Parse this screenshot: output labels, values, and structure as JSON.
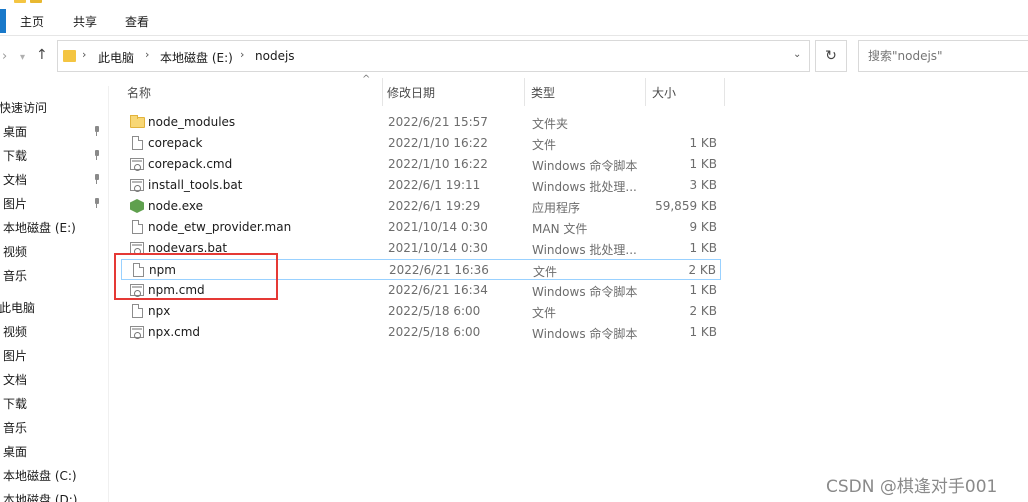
{
  "ribbon": {
    "tabs": [
      "主页",
      "共享",
      "查看"
    ]
  },
  "address": {
    "crumbs": [
      "此电脑",
      "本地磁盘 (E:)",
      "nodejs"
    ],
    "search_placeholder": "搜索\"nodejs\""
  },
  "sidebar": {
    "items": [
      {
        "label": "快速访问",
        "pinned": false,
        "head": true
      },
      {
        "label": "桌面",
        "pinned": true
      },
      {
        "label": "下载",
        "pinned": true
      },
      {
        "label": "文档",
        "pinned": true
      },
      {
        "label": "图片",
        "pinned": true
      },
      {
        "label": "本地磁盘 (E:)",
        "pinned": false
      },
      {
        "label": "视频",
        "pinned": false
      },
      {
        "label": "音乐",
        "pinned": false
      },
      {
        "label": "此电脑",
        "pinned": false,
        "head": true
      },
      {
        "label": "视频",
        "pinned": false
      },
      {
        "label": "图片",
        "pinned": false
      },
      {
        "label": "文档",
        "pinned": false
      },
      {
        "label": "下载",
        "pinned": false
      },
      {
        "label": "音乐",
        "pinned": false
      },
      {
        "label": "桌面",
        "pinned": false
      },
      {
        "label": "本地磁盘 (C:)",
        "pinned": false
      },
      {
        "label": "本地磁盘 (D:)",
        "pinned": false
      }
    ]
  },
  "columns": {
    "name": "名称",
    "date": "修改日期",
    "type": "类型",
    "size": "大小"
  },
  "files": [
    {
      "name": "node_modules",
      "date": "2022/6/21 15:57",
      "type": "文件夹",
      "size": "",
      "icon": "folder-icon"
    },
    {
      "name": "corepack",
      "date": "2022/1/10 16:22",
      "type": "文件",
      "size": "1 KB",
      "icon": "file-icon"
    },
    {
      "name": "corepack.cmd",
      "date": "2022/1/10 16:22",
      "type": "Windows 命令脚本",
      "size": "1 KB",
      "icon": "script-icon"
    },
    {
      "name": "install_tools.bat",
      "date": "2022/6/1 19:11",
      "type": "Windows 批处理...",
      "size": "3 KB",
      "icon": "script-icon"
    },
    {
      "name": "node.exe",
      "date": "2022/6/1 19:29",
      "type": "应用程序",
      "size": "59,859 KB",
      "icon": "nodejs-icon"
    },
    {
      "name": "node_etw_provider.man",
      "date": "2021/10/14 0:30",
      "type": "MAN 文件",
      "size": "9 KB",
      "icon": "file-icon"
    },
    {
      "name": "nodevars.bat",
      "date": "2021/10/14 0:30",
      "type": "Windows 批处理...",
      "size": "1 KB",
      "icon": "script-icon"
    },
    {
      "name": "npm",
      "date": "2022/6/21 16:36",
      "type": "文件",
      "size": "2 KB",
      "icon": "file-icon",
      "selected": true
    },
    {
      "name": "npm.cmd",
      "date": "2022/6/21 16:34",
      "type": "Windows 命令脚本",
      "size": "1 KB",
      "icon": "script-icon"
    },
    {
      "name": "npx",
      "date": "2022/5/18 6:00",
      "type": "文件",
      "size": "2 KB",
      "icon": "file-icon"
    },
    {
      "name": "npx.cmd",
      "date": "2022/5/18 6:00",
      "type": "Windows 命令脚本",
      "size": "1 KB",
      "icon": "script-icon"
    }
  ],
  "watermark": "CSDN @棋逢对手001",
  "colors": {
    "accent": "#1979ca",
    "selection_border": "#99d1ff",
    "annotation_red": "#e53935",
    "folder_yellow": "#f8d775",
    "node_green": "#5fa04e"
  }
}
